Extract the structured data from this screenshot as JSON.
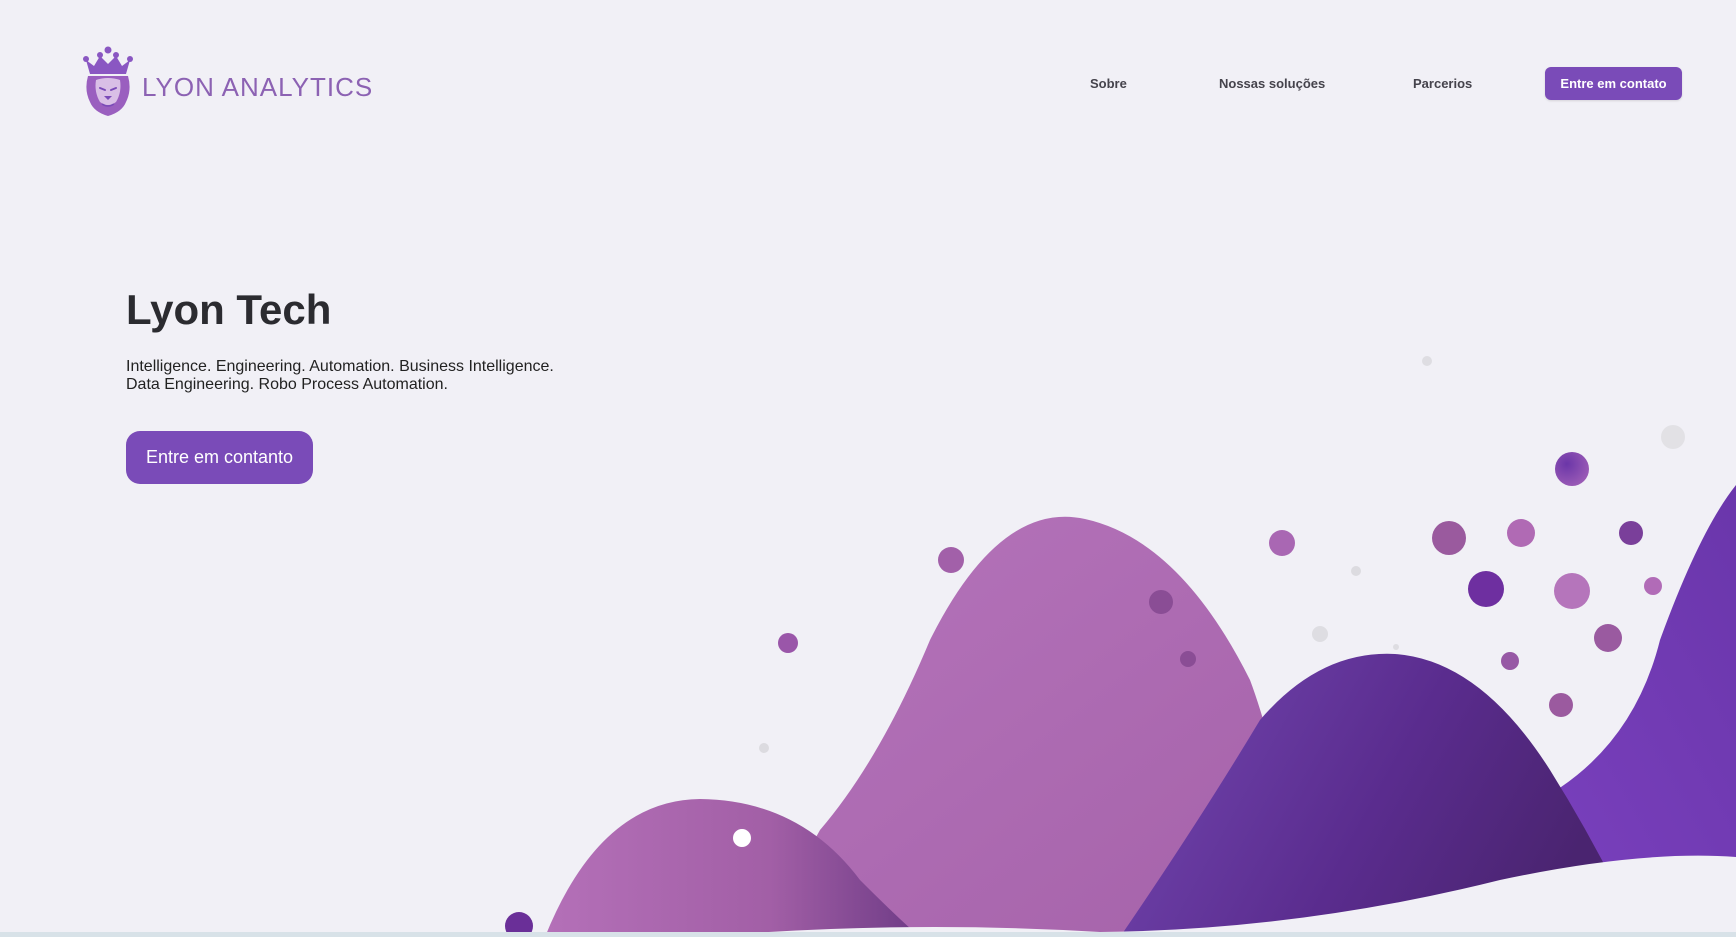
{
  "header": {
    "brand": "LYON ANALYTICS",
    "nav": {
      "about": "Sobre",
      "solutions": "Nossas soluções",
      "partners": "Parcerios"
    },
    "cta_label": "Entre em contato"
  },
  "hero": {
    "title": "Lyon Tech",
    "subtitle_line1": "Intelligence. Engineering. Automation. Business Intelligence.",
    "subtitle_line2": "Data Engineering. Robo Process Automation.",
    "cta_label": "Entre em contanto"
  },
  "colors": {
    "background": "#f1f0f6",
    "accent": "#7a4bb8",
    "brand_text": "#8c62b3",
    "wave_pink": "#ad6db3",
    "wave_purple": "#6a3aa6",
    "wave_dark": "#5a2f8a"
  },
  "icons": {
    "logo": "crowned-lion-icon"
  }
}
